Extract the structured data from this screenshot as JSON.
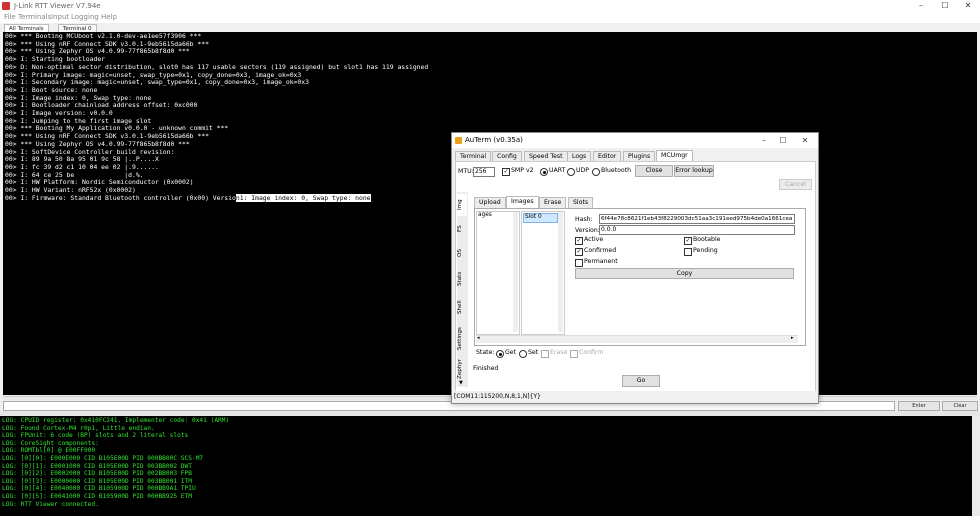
{
  "window": {
    "title": "J-Link RTT Viewer V7.94e",
    "minimize": "–",
    "maximize": "☐",
    "close": "✕"
  },
  "menu": [
    "File",
    "Terminals",
    "Input",
    "Logging",
    "Help"
  ],
  "terminal_tabs": [
    "All Terminals",
    "Terminal 0"
  ],
  "terminal_lines": [
    "00> *** Booting MCUboot v2.1.0-dev-ae1ee57f3906 ***",
    "00> *** Using nRF Connect SDK v3.0.1-9eb5615da66b ***",
    "00> *** Using Zephyr OS v4.0.99-77f865b8f8d0 ***",
    "00> I: Starting bootloader",
    "00> D: Non-optimal sector distribution, slot0 has 117 usable sectors (119 assigned) but slot1 has 119 assigned",
    "00> I: Primary image: magic=unset, swap_type=0x1, copy_done=0x3, image_ok=0x3",
    "00> I: Secondary image: magic=unset, swap_type=0x1, copy_done=0x3, image_ok=0x3",
    "00> I: Boot source: none",
    "00> I: Image index: 0, Swap type: none",
    "00> I: Bootloader chainload address offset: 0xc000",
    "00> I: Image version: v0.0.0",
    "00> I: Jumping to the first image slot",
    "00> *** Booting My Application v0.0.0 - unknown commit ***",
    "00> *** Using nRF Connect SDK v3.0.1-9eb5615da66b ***",
    "00> *** Using Zephyr OS v4.0.99-77f865b8f8d0 ***",
    "00> I: SoftDevice Controller build revision:",
    "00> I: 89 9a 50 8a 95 01 9c 58 |..P....X",
    "00> I: fc 39 d2 c1 10 04 ee 02 |.9......",
    "00> I: 64 ce 25 be             |d.%.",
    "00> I: HW Platform: Nordic Semiconductor (0x0002)",
    "00> I: HW Variant: nRF52x (0x0002)"
  ],
  "terminal_last_line": {
    "normal": "00> I: Firmware: Standard Bluetooth controller (0x00) Versio",
    "highlighted": "n1: Image index: 0, Swap type: none"
  },
  "input_buttons": {
    "enter": "Enter",
    "clear": "Clear"
  },
  "log_lines": [
    "LOG: CPUID register: 0x410FC241. Implementer code: 0x41 (ARM)",
    "LOG: Found Cortex-M4 r0p1, Little endian.",
    "LOG: FPUnit: 6 code (BP) slots and 2 literal slots",
    "LOG: CoreSight components:",
    "LOG: ROMTbl[0] @ E00FF000",
    "LOG: [0][0]: E000E000 CID B105E00D PID 000BB00C SCS-M7",
    "LOG: [0][1]: E0001000 CID B105E00D PID 003BB002 DWT",
    "LOG: [0][2]: E0002000 CID B105E00D PID 002BB003 FPB",
    "LOG: [0][3]: E0000000 CID B105E00D PID 003BB001 ITM",
    "LOG: [0][4]: E0040000 CID B105900D PID 000BB9A1 TPIU",
    "LOG: [0][5]: E0041000 CID B105900D PID 000BB925 ETM",
    "LOG: RTT Viewer connected."
  ],
  "auterm": {
    "title": "AuTerm (v0.35a)",
    "tabs": [
      "Terminal",
      "Config",
      "Speed Test",
      "Logs",
      "Editor",
      "Plugins",
      "MCUmgr"
    ],
    "mtu_label": "MTU:",
    "mtu_value": "256",
    "smp_label": "SMP v2",
    "transports": [
      "UART",
      "UDP",
      "Bluetooth"
    ],
    "close_btn": "Close",
    "error_btn": "Error lookup",
    "cancel_btn": "Cancel",
    "side_tabs": [
      "Img",
      "FS",
      "OS",
      "Stats",
      "Shell",
      "Settings",
      "Zephyr"
    ],
    "sub_tabs": [
      "Upload",
      "Images",
      "Erase",
      "Slots"
    ],
    "list_left": "ages",
    "list_right": "Slot 0",
    "hash_label": "Hash:",
    "hash_value": "6f44e78c8621f1eb43f8229003dc51aa3c191eed975b4de0a1661cea",
    "version_label": "Version:",
    "version_value": "0.0.0",
    "checks": [
      {
        "label": "Active",
        "checked": true
      },
      {
        "label": "Bootable",
        "checked": true
      },
      {
        "label": "Confirmed",
        "checked": true
      },
      {
        "label": "Pending",
        "checked": false
      },
      {
        "label": "Permanent",
        "checked": false
      }
    ],
    "copy_btn": "Copy",
    "state_label": "State:",
    "state_options": [
      "Get",
      "Set",
      "Erase",
      "Confirm"
    ],
    "status_text": "Finished",
    "go_btn": "Go",
    "statusbar": "[COM11:115200,N,8,1,N]{Y}"
  }
}
